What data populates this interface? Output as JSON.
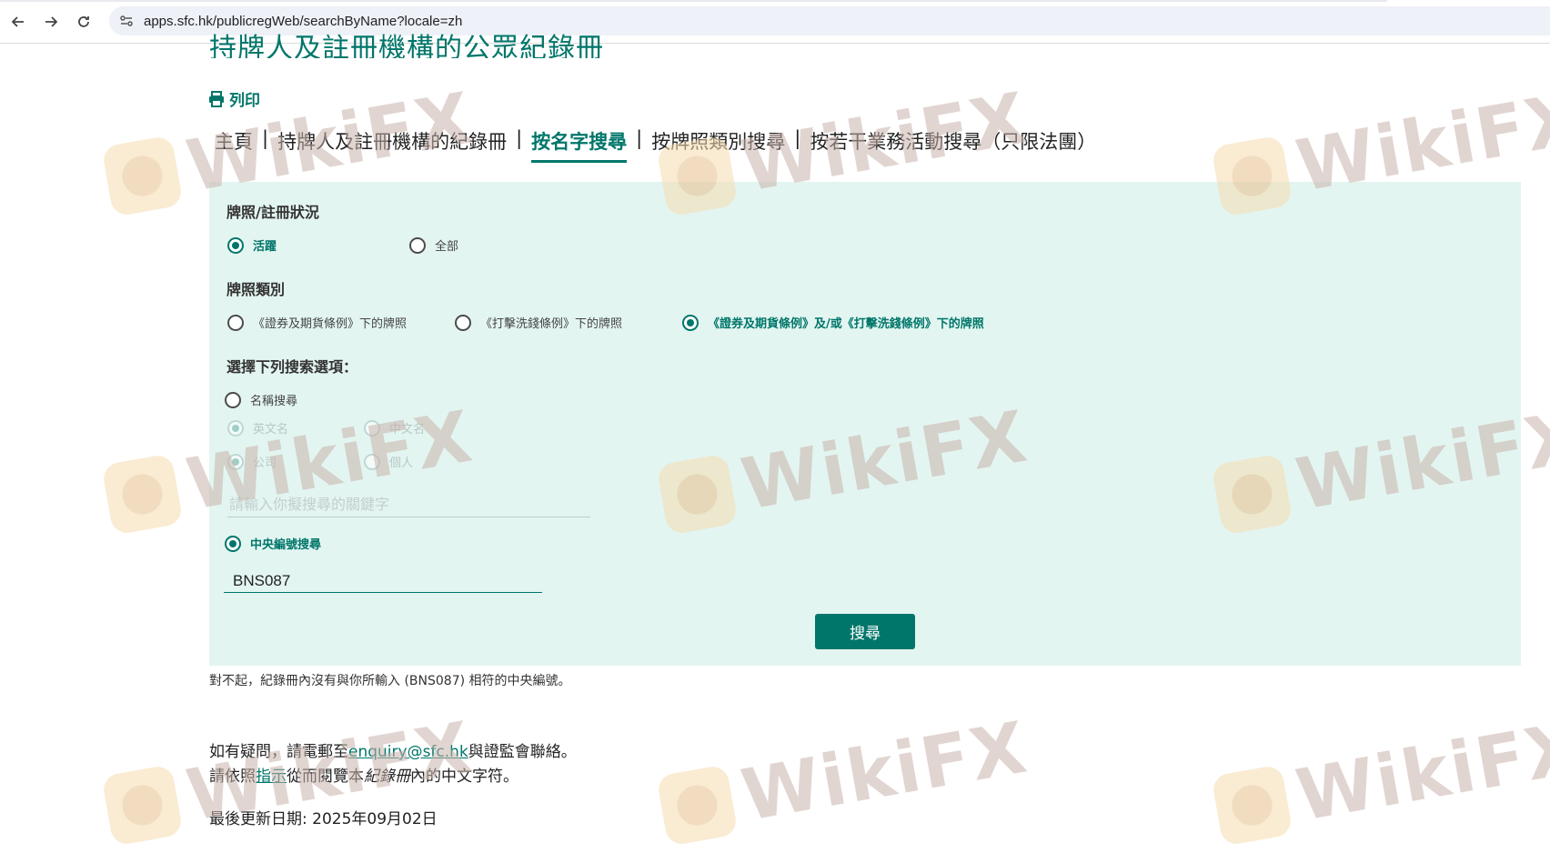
{
  "browser": {
    "url": "apps.sfc.hk/publicregWeb/searchByName?locale=zh"
  },
  "page": {
    "title": "持牌人及註冊機構的公眾紀錄冊",
    "print_label": "列印"
  },
  "tabs": [
    {
      "label": "主頁",
      "active": false
    },
    {
      "label": "持牌人及註冊機構的紀錄冊",
      "active": false
    },
    {
      "label": "按名字搜尋",
      "active": true
    },
    {
      "label": "按牌照類別搜尋",
      "active": false
    },
    {
      "label": "按若干業務活動搜尋（只限法團）",
      "active": false
    }
  ],
  "tab_separator": "|",
  "search": {
    "status_label": "牌照/註冊狀況",
    "status_options": [
      {
        "label": "活躍",
        "selected": true
      },
      {
        "label": "全部",
        "selected": false
      }
    ],
    "license_type_label": "牌照類別",
    "license_type_options": [
      {
        "label": "《證券及期貨條例》下的牌照",
        "selected": false
      },
      {
        "label": "《打擊洗錢條例》下的牌照",
        "selected": false
      },
      {
        "label": "《證券及期貨條例》及/或《打擊洗錢條例》下的牌照",
        "selected": true
      }
    ],
    "options_label": "選擇下列搜索選項：",
    "name_search_label": "名稱搜尋",
    "name_lang_options": [
      {
        "label": "英文名",
        "selected": true
      },
      {
        "label": "中文名",
        "selected": false
      }
    ],
    "entity_options": [
      {
        "label": "公司",
        "selected": true
      },
      {
        "label": "個人",
        "selected": false
      }
    ],
    "keyword_placeholder": "請輸入你擬搜尋的關鍵字",
    "ce_search_label": "中央編號搜尋",
    "ce_value": "BNS087",
    "button_label": "搜尋"
  },
  "result_message": "對不起，紀錄冊內沒有與你所輸入 (BNS087) 相符的中央編號。",
  "footer": {
    "contact_prefix": "如有疑問，請電郵至",
    "contact_email": "enquiry@sfc.hk",
    "contact_suffix": "與證監會聯絡。",
    "guide_prefix": "請依照",
    "guide_link": "指示",
    "guide_middle": "從而閱覽本",
    "guide_italic": "紀錄冊",
    "guide_suffix": "內的中文字符。",
    "last_updated": "最後更新日期: 2025年09月02日"
  },
  "watermark_text": "WikiFX",
  "colors": {
    "accent": "#00766a",
    "panel_bg": "#e3f5f1"
  }
}
